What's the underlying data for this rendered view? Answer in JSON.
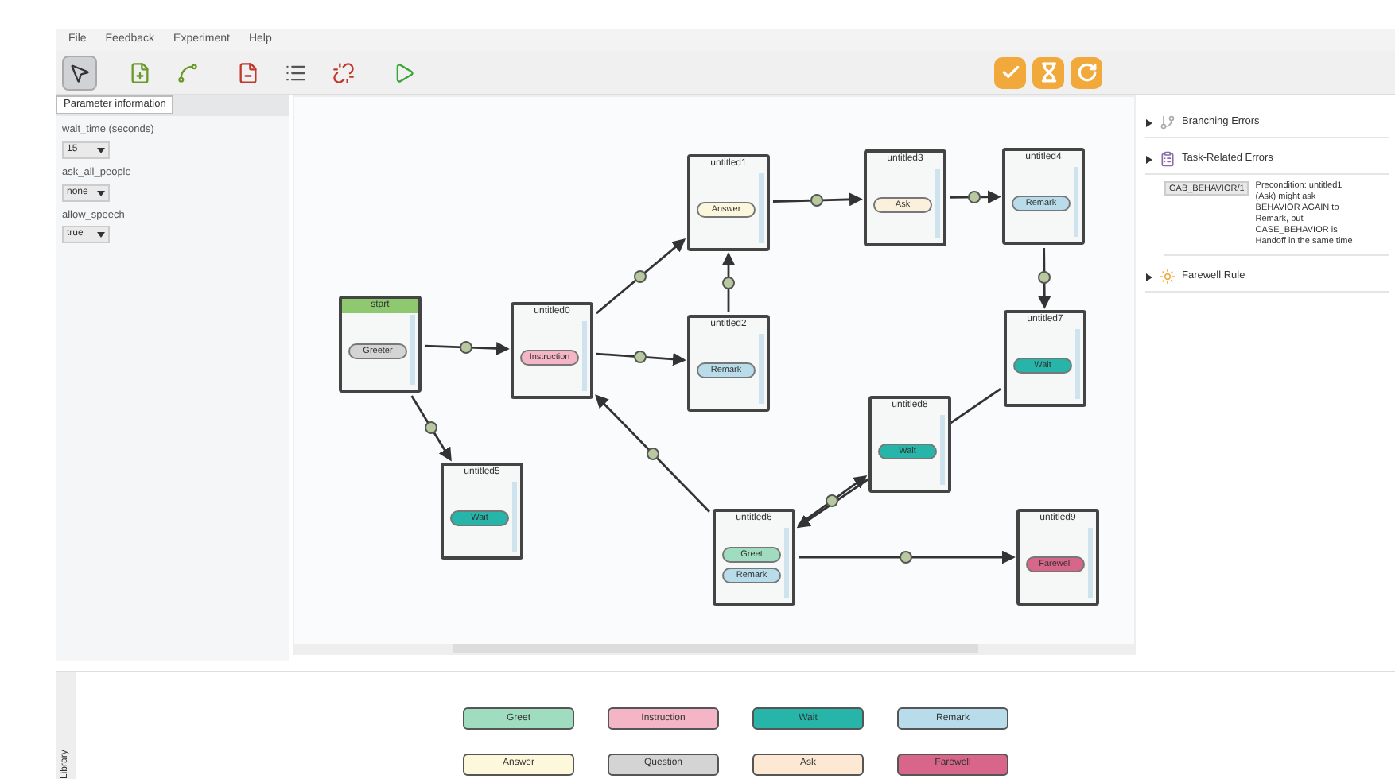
{
  "menu": [
    "File",
    "Feedback",
    "Experiment",
    "Help"
  ],
  "toolbar": [
    {
      "kind": "select",
      "selected": true
    },
    {
      "kind": "add-state",
      "selected": false
    },
    {
      "kind": "add-edge",
      "selected": false
    },
    {
      "kind": "remove-state",
      "selected": false
    },
    {
      "kind": "list",
      "selected": false
    },
    {
      "kind": "remove-edge",
      "selected": false
    },
    {
      "kind": "run",
      "selected": false
    }
  ],
  "actions": [
    {
      "kind": "check"
    },
    {
      "kind": "hourglass"
    },
    {
      "kind": "refresh"
    }
  ],
  "parameters": {
    "tab": "Parameter information",
    "fields": [
      {
        "label": "wait_time (seconds)",
        "value": "15"
      },
      {
        "label": "ask_all_people",
        "value": "none"
      },
      {
        "label": "allow_speech",
        "value": "true"
      }
    ]
  },
  "nodes": [
    {
      "kind": "start",
      "title": "start",
      "behaviors": [
        {
          "label": "Greeter",
          "color": "#d4d4d4"
        }
      ]
    },
    {
      "kind": "state",
      "title": "untitled0",
      "behaviors": [
        {
          "label": "Instruction",
          "color": "#f4b6c6"
        }
      ]
    },
    {
      "kind": "state",
      "title": "untitled1",
      "behaviors": [
        {
          "label": "Answer",
          "color": "#fbf6dc"
        }
      ]
    },
    {
      "kind": "state",
      "title": "untitled2",
      "behaviors": [
        {
          "label": "Remark",
          "color": "#b9dcea"
        }
      ]
    },
    {
      "kind": "state",
      "title": "untitled3",
      "behaviors": [
        {
          "label": "Ask",
          "color": "#fbf0dc"
        }
      ]
    },
    {
      "kind": "state",
      "title": "untitled4",
      "behaviors": [
        {
          "label": "Remark",
          "color": "#b9dcea"
        }
      ]
    },
    {
      "kind": "state",
      "title": "untitled5",
      "behaviors": [
        {
          "label": "Wait",
          "color": "#26b5a8"
        }
      ]
    },
    {
      "kind": "state",
      "title": "untitled6",
      "behaviors": [
        {
          "label": "Greet",
          "color": "#9fdcc0"
        },
        {
          "label": "Remark",
          "color": "#b9dcea"
        }
      ]
    },
    {
      "kind": "state",
      "title": "untitled7",
      "behaviors": [
        {
          "label": "Wait",
          "color": "#26b5a8"
        }
      ]
    },
    {
      "kind": "state",
      "title": "untitled8",
      "behaviors": [
        {
          "label": "Wait",
          "color": "#26b5a8"
        }
      ]
    },
    {
      "kind": "state",
      "title": "untitled9",
      "behaviors": [
        {
          "label": "Farewell",
          "color": "#d8668a"
        }
      ]
    }
  ],
  "errors": [
    {
      "kind": "branch",
      "label": "Branching Errors"
    },
    {
      "kind": "task",
      "label": "Task-Related Errors",
      "details": [
        {
          "code": "GAB_BEHAVIOR/1",
          "text": "Precondition: untitled1 (Ask) might ask BEHAVIOR AGAIN to Remark, but CASE_BEHAVIOR is Handoff in the same time"
        }
      ]
    },
    {
      "kind": "farewell",
      "label": "Farewell Rule"
    }
  ],
  "library": {
    "tab": "Library",
    "items": [
      {
        "label": "Greet",
        "color": "#9fdcc0"
      },
      {
        "label": "Instruction",
        "color": "#f4b6c6"
      },
      {
        "label": "Wait",
        "color": "#26b5a8"
      },
      {
        "label": "Remark",
        "color": "#b9dcea"
      },
      {
        "label": "Answer",
        "color": "#fdf8dc"
      },
      {
        "label": "Question",
        "color": "#d4d4d4"
      },
      {
        "label": "Ask",
        "color": "#fde8d4"
      },
      {
        "label": "Farewell",
        "color": "#d8668a"
      }
    ]
  }
}
